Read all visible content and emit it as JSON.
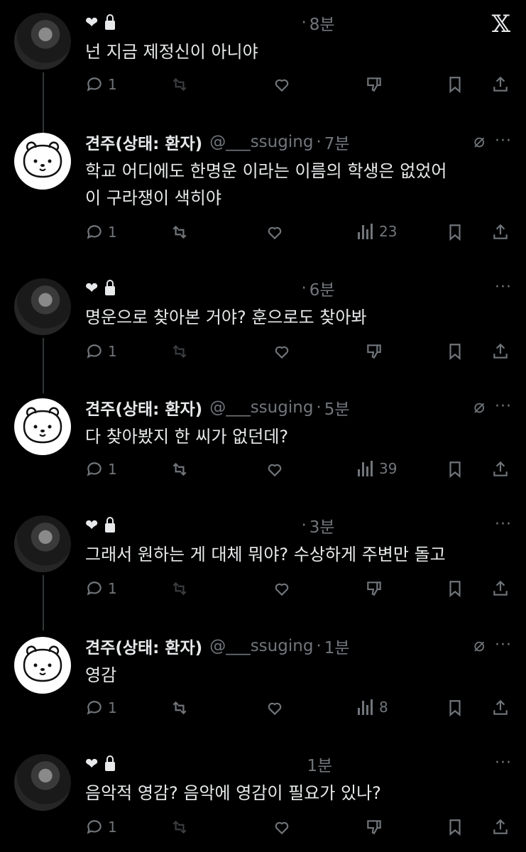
{
  "tweets": [
    {
      "kind": "self",
      "time": "8분",
      "text": "넌 지금 제정신이 아니야",
      "replies": "1",
      "views": null
    },
    {
      "kind": "other",
      "name": "견주(상태: 환자)",
      "handle": "@___ssuging",
      "time": "7분",
      "text": "학교 어디에도 한명운 이라는 이름의 학생은 없었어\n이 구라쟁이 색히야",
      "replies": "1",
      "views": "23"
    },
    {
      "kind": "self",
      "time": "6분",
      "text": "명운으로 찾아본 거야? 훈으로도 찾아봐",
      "replies": "1",
      "views": null
    },
    {
      "kind": "other",
      "name": "견주(상태: 환자)",
      "handle": "@___ssuging",
      "time": "5분",
      "text": "다 찾아봤지 한 씨가 없던데?",
      "replies": "1",
      "views": "39"
    },
    {
      "kind": "self",
      "time": "3분",
      "text": "그래서 원하는 게 대체 뭐야? 수상하게 주변만 돌고",
      "replies": "1",
      "views": null
    },
    {
      "kind": "other",
      "name": "견주(상태: 환자)",
      "handle": "@___ssuging",
      "time": "1분",
      "text": "영감",
      "replies": "1",
      "views": "8"
    },
    {
      "kind": "self",
      "time": "1분",
      "text": "음악적 영감? 음악에 영감이 필요가 있나?",
      "replies": "1",
      "views": null
    }
  ],
  "icons": {
    "heart": "❤",
    "x_logo": "𝕏",
    "more": "···",
    "grok": "⌀"
  }
}
